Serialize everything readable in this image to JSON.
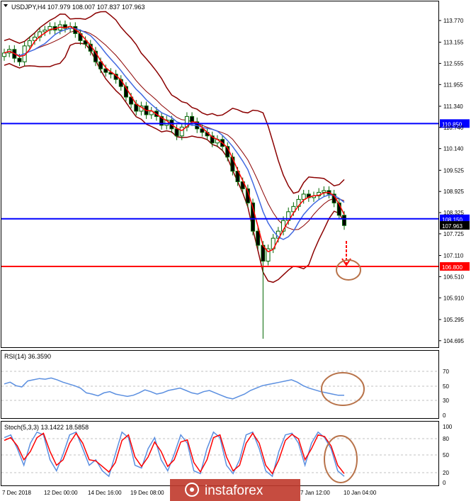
{
  "header": {
    "symbol_line": "USDJPY,H4  107.979 108.007 107.837 107.963"
  },
  "price_axis": {
    "ticks": [
      "113.770",
      "113.155",
      "112.555",
      "111.955",
      "111.340",
      "110.740",
      "110.140",
      "109.525",
      "108.925",
      "108.325",
      "107.725",
      "107.110",
      "106.510",
      "105.910",
      "105.295",
      "104.695"
    ]
  },
  "levels": [
    {
      "label": "110.850",
      "value": 110.85,
      "color": "#0000ff"
    },
    {
      "label": "108.150",
      "value": 108.15,
      "color": "#0000ff"
    },
    {
      "label": "106.800",
      "value": 106.8,
      "color": "#ff0000"
    }
  ],
  "current_price": {
    "label": "107.963",
    "value": 107.963
  },
  "rsi": {
    "title": "RSI(14) 36.3590",
    "ticks": [
      "70",
      "50",
      "30",
      "0"
    ]
  },
  "stoch": {
    "title": "Stoch(5,3,3) 13.1422 18.5858",
    "ticks": [
      "100",
      "80",
      "50",
      "20",
      "0"
    ]
  },
  "time_axis": {
    "labels": [
      "7 Dec 2018",
      "12 Dec 00:00",
      "14 Dec 16:00",
      "19 Dec 08:00",
      "7 Jan 12:00",
      "10 Jan 04:00"
    ]
  },
  "watermark": "instaforex",
  "colors": {
    "candles": "#006400",
    "bollinger": "#8b0000",
    "ma_fast": "#ff0000",
    "ma_slow": "#4169e1",
    "rsi_line": "#5b8fe0",
    "stoch_main": "#5b8fe0",
    "stoch_signal": "#ff0000",
    "annotation": "#b8734a"
  },
  "chart_data": {
    "type": "candlestick",
    "symbol": "USDJPY",
    "timeframe": "H4",
    "ylim": [
      104.5,
      114.0
    ],
    "price_close": [
      112.85,
      112.95,
      112.7,
      112.6,
      113.05,
      113.2,
      113.3,
      113.45,
      113.5,
      113.6,
      113.5,
      113.65,
      113.55,
      113.6,
      113.4,
      113.2,
      113.1,
      112.9,
      112.6,
      112.4,
      112.3,
      112.25,
      112.1,
      111.9,
      111.6,
      111.4,
      111.2,
      111.35,
      111.1,
      111.2,
      111.05,
      110.8,
      110.95,
      110.7,
      110.5,
      110.75,
      111.05,
      110.9,
      110.7,
      110.6,
      110.5,
      110.3,
      110.4,
      110.2,
      109.9,
      109.5,
      109.2,
      109.0,
      108.6,
      107.8,
      107.4,
      106.95,
      107.3,
      107.6,
      107.8,
      108.1,
      108.35,
      108.5,
      108.7,
      108.85,
      108.75,
      108.8,
      108.9,
      108.95,
      108.85,
      108.6,
      108.25,
      107.96
    ],
    "series": [
      {
        "name": "RSI",
        "values": [
          55,
          58,
          52,
          50,
          60,
          62,
          64,
          63,
          65,
          62,
          58,
          55,
          52,
          48,
          40,
          38,
          35,
          40,
          42,
          38,
          36,
          34,
          36,
          40,
          45,
          42,
          38,
          40,
          44,
          46,
          48,
          44,
          40,
          38,
          42,
          44,
          40,
          36,
          32,
          30,
          34,
          38,
          44,
          48,
          52,
          54,
          56,
          58,
          60,
          62,
          58,
          52,
          48,
          45,
          42,
          40,
          38,
          36,
          36
        ]
      },
      {
        "name": "Stoch main",
        "values": [
          80,
          85,
          60,
          30,
          70,
          90,
          85,
          40,
          20,
          50,
          85,
          90,
          60,
          30,
          40,
          20,
          10,
          50,
          90,
          80,
          30,
          25,
          60,
          80,
          40,
          20,
          50,
          85,
          70,
          20,
          15,
          60,
          90,
          80,
          30,
          15,
          40,
          85,
          90,
          60,
          20,
          10,
          55,
          85,
          88,
          70,
          30,
          70,
          90,
          80,
          60,
          20,
          10
        ]
      },
      {
        "name": "Stoch signal",
        "values": [
          75,
          80,
          65,
          40,
          55,
          80,
          88,
          55,
          30,
          40,
          70,
          88,
          70,
          40,
          38,
          28,
          18,
          35,
          75,
          85,
          45,
          28,
          45,
          72,
          55,
          28,
          40,
          72,
          76,
          35,
          18,
          40,
          80,
          85,
          45,
          20,
          30,
          70,
          88,
          70,
          30,
          15,
          40,
          75,
          86,
          78,
          40,
          60,
          85,
          82,
          65,
          30,
          15
        ]
      }
    ]
  }
}
